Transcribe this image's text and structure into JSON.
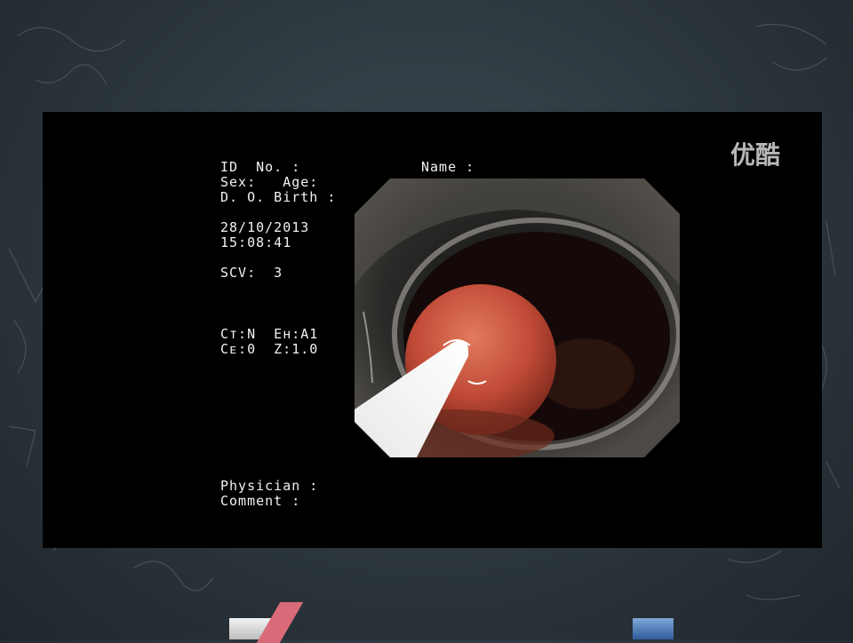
{
  "overlay": {
    "id_no": "ID  No. :",
    "name": "Name :",
    "sex_age": "Sex:   Age:",
    "dob": "D. O. Birth :",
    "date": "28/10/2013",
    "time": "15:08:41",
    "scv": "SCV:  3",
    "ct_eh": "Cт:N  Eн:A1",
    "ce_z": "Cᴇ:0  Z:1.0",
    "physician": "Physician :",
    "comment": "Comment :"
  },
  "watermark": {
    "text": "优酷"
  },
  "colors": {
    "board": "#2c363d",
    "screen": "#000000",
    "polyp": "#c8563f",
    "lumen": "#1a0d0a"
  }
}
